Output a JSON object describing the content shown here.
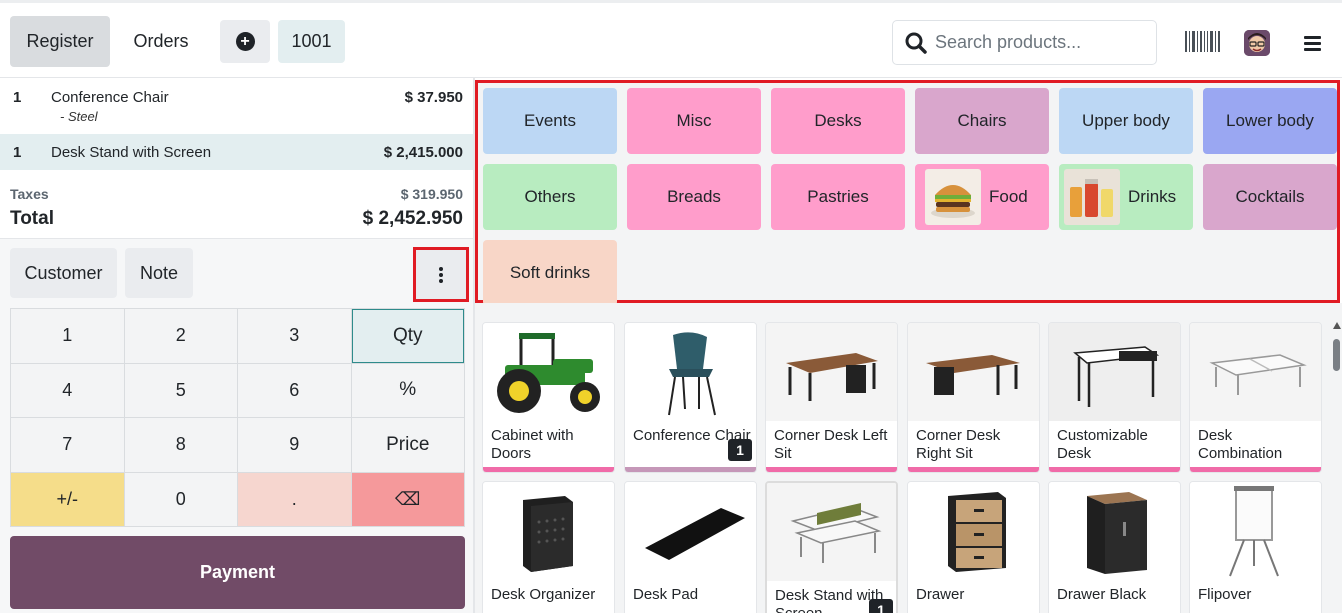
{
  "header": {
    "register_label": "Register",
    "orders_label": "Orders",
    "order_number": "1001",
    "search_placeholder": "Search products..."
  },
  "order_lines": [
    {
      "qty": "1",
      "name": "Conference Chair",
      "variant": "- Steel",
      "price": "$ 37.950"
    },
    {
      "qty": "1",
      "name": "Desk Stand with Screen",
      "price": "$ 2,415.000"
    }
  ],
  "totals": {
    "taxes_label": "Taxes",
    "taxes_value": "$ 319.950",
    "total_label": "Total",
    "total_value": "$ 2,452.950"
  },
  "actions": {
    "customer_label": "Customer",
    "note_label": "Note",
    "payment_label": "Payment"
  },
  "numpad": [
    "1",
    "2",
    "3",
    "Qty",
    "4",
    "5",
    "6",
    "%",
    "7",
    "8",
    "9",
    "Price",
    "+/-",
    "0",
    ".",
    "⌫"
  ],
  "categories": [
    {
      "label": "Events",
      "color": "#bcd7f4"
    },
    {
      "label": "Misc",
      "color": "#ff9dcb"
    },
    {
      "label": "Desks",
      "color": "#ff9dcb"
    },
    {
      "label": "Chairs",
      "color": "#d9a6cc"
    },
    {
      "label": "Upper body",
      "color": "#bcd7f4"
    },
    {
      "label": "Lower body",
      "color": "#9aa7f2"
    },
    {
      "label": "Others",
      "color": "#b8ecc0"
    },
    {
      "label": "Breads",
      "color": "#ff9dcb"
    },
    {
      "label": "Pastries",
      "color": "#ff9dcb"
    },
    {
      "label": "Food",
      "color": "#ff9dcb",
      "icon": "burger-image"
    },
    {
      "label": "Drinks",
      "color": "#b8ecc0",
      "icon": "drinks-image"
    },
    {
      "label": "Cocktails",
      "color": "#d9a6cc"
    },
    {
      "label": "Soft drinks",
      "color": "#f8d6c7"
    }
  ],
  "products": [
    {
      "name": "Cabinet with Doors",
      "icon": "tractor-image"
    },
    {
      "name": "Conference Chair",
      "icon": "chair-image",
      "in_cart": "1"
    },
    {
      "name": "Corner Desk Left Sit",
      "icon": "corner-desk-image"
    },
    {
      "name": "Corner Desk Right Sit",
      "icon": "corner-desk-image"
    },
    {
      "name": "Customizable Desk",
      "icon": "desk-image"
    },
    {
      "name": "Desk Combination",
      "icon": "desk-combination-image"
    },
    {
      "name": "Desk Organizer",
      "icon": "organizer-image"
    },
    {
      "name": "Desk Pad",
      "icon": "desk-pad-image"
    },
    {
      "name": "Desk Stand with Screen",
      "icon": "desk-stand-image",
      "in_cart": "1"
    },
    {
      "name": "Drawer",
      "icon": "drawer-image"
    },
    {
      "name": "Drawer Black",
      "icon": "drawer-black-image"
    },
    {
      "name": "Flipover",
      "icon": "flipover-image"
    }
  ]
}
